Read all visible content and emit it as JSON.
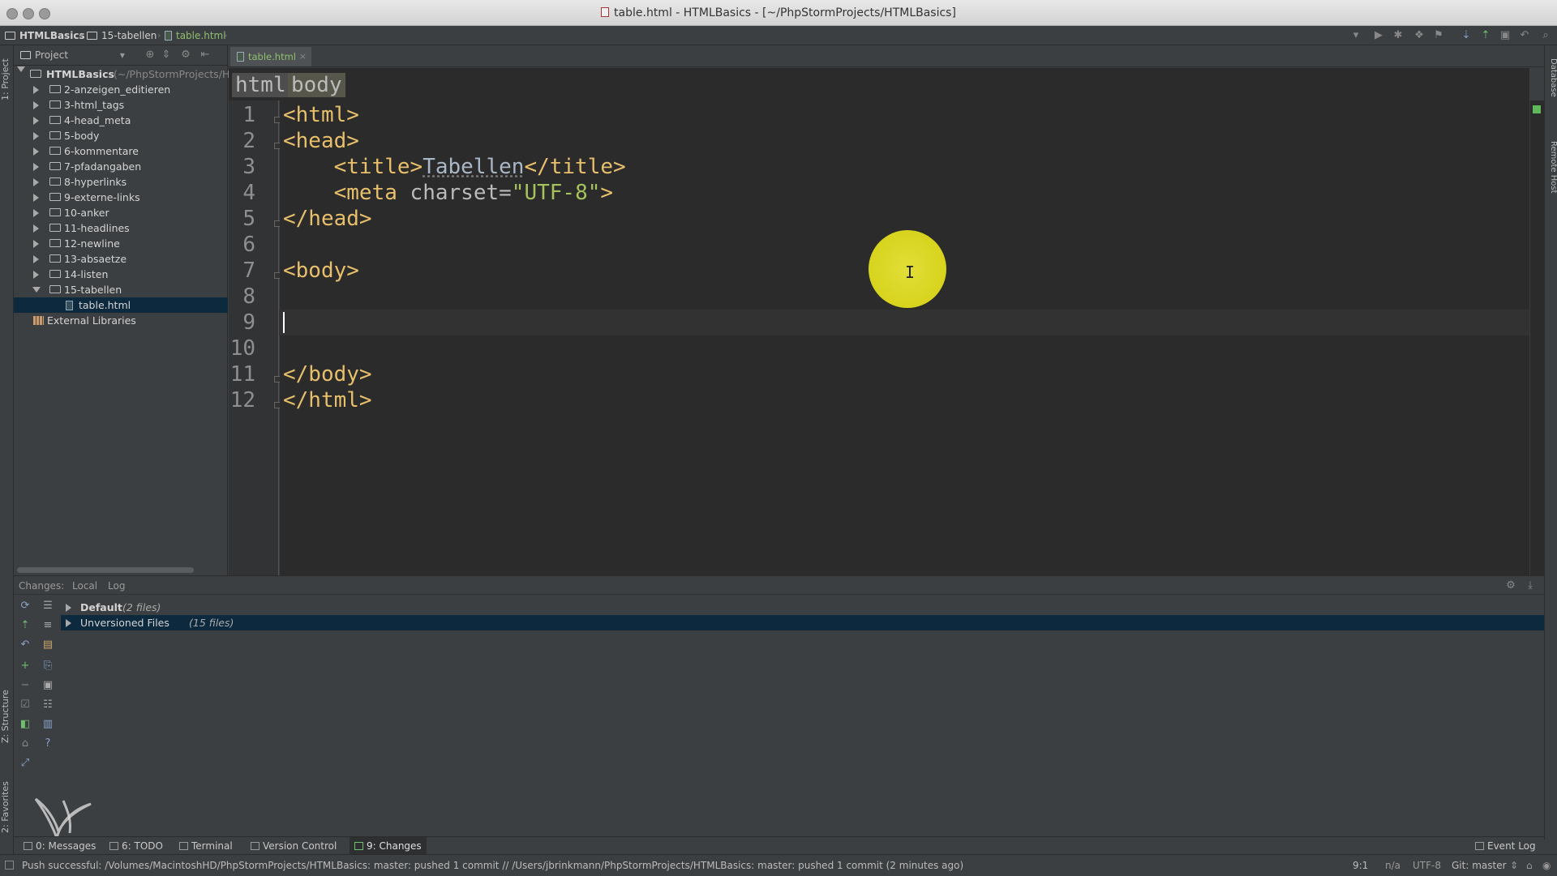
{
  "window": {
    "title": "table.html - HTMLBasics - [~/PhpStormProjects/HTMLBasics]"
  },
  "navbar": {
    "crumbs": [
      "HTMLBasics",
      "15-tabellen",
      "table.html"
    ]
  },
  "left_strip": {
    "project": "1: Project",
    "structure": "Z: Structure",
    "favorites": "2: Favorites"
  },
  "right_strip": {
    "database": "Database",
    "remote_host": "Remote Host"
  },
  "project_panel": {
    "title": "Project",
    "root": {
      "label": "HTMLBasics",
      "path": "(~/PhpStormProjects/HTMLBasics)"
    },
    "folders": [
      "2-anzeigen_editieren",
      "3-html_tags",
      "4-head_meta",
      "5-body",
      "6-kommentare",
      "7-pfadangaben",
      "8-hyperlinks",
      "9-externe-links",
      "10-anker",
      "11-headlines",
      "12-newline",
      "13-absaetze",
      "14-listen",
      "15-tabellen"
    ],
    "open_file": "table.html",
    "external": "External Libraries"
  },
  "editor": {
    "tab_label": "table.html",
    "tag_breadcrumbs": [
      "html",
      "body"
    ],
    "line_numbers": [
      "1",
      "2",
      "3",
      "4",
      "5",
      "6",
      "7",
      "8",
      "9",
      "10",
      "11",
      "12"
    ],
    "lines": {
      "l1": "<html>",
      "l2": "<head>",
      "l3_open": "<title>",
      "l3_text": "Tabellen",
      "l3_close": "</title>",
      "l4_tag": "<meta",
      "l4_attr": " charset=",
      "l4_val": "\"UTF-8\"",
      "l4_end": ">",
      "l5": "</head>",
      "l7": "<body>",
      "l11": "</body>",
      "l12": "</html>"
    },
    "cursor_line": 9
  },
  "changes_panel": {
    "label": "Changes:",
    "tabs": [
      "Local",
      "Log"
    ],
    "default_group": {
      "name": "Default",
      "count": "(2 files)"
    },
    "unversioned_group": {
      "name": "Unversioned Files",
      "count": "(15 files)"
    }
  },
  "tool_tabs": {
    "messages": "0: Messages",
    "todo": "6: TODO",
    "terminal": "Terminal",
    "vcs": "Version Control",
    "changes": "9: Changes",
    "event_log": "Event Log"
  },
  "status": {
    "message": "Push successful: /Volumes/MacintoshHD/PhpStormProjects/HTMLBasics: master: pushed 1 commit // /Users/jbrinkmann/PhpStormProjects/HTMLBasics: master: pushed 1 commit (2 minutes ago)",
    "position": "9:1",
    "na": "n/a",
    "encoding": "UTF-8",
    "git": "Git: master"
  },
  "colors": {
    "tag": "#e8bf6a",
    "attr_value": "#a5c25c",
    "selection": "#0d293e",
    "cursor_highlight": "#e6e21c"
  }
}
